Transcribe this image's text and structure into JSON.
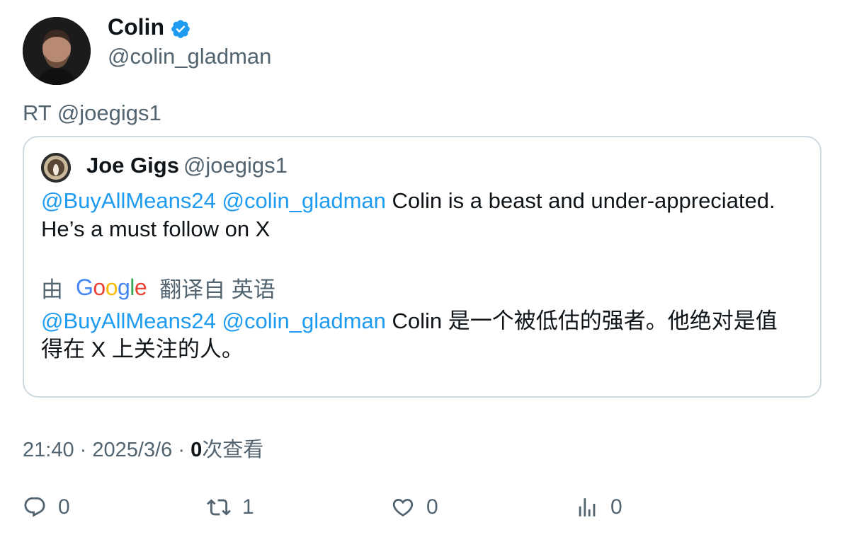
{
  "author": {
    "name": "Colin",
    "handle": "@colin_gladman",
    "verified": true
  },
  "retweet_label": "RT @joegigs1",
  "quoted": {
    "name": "Joe Gigs",
    "handle": "@joegigs1",
    "mentions": [
      "@BuyAllMeans24",
      "@colin_gladman"
    ],
    "text_en_part1": "Colin is a beast and under-appreciated.",
    "text_en_part2": "He’s a must follow on X",
    "translate_prefix": "由",
    "translate_brand": "Google",
    "translate_suffix": "翻译自 英语",
    "text_zh_part1": "Colin 是一个被低估的强者。他绝对是值",
    "text_zh_part2": "得在 X 上关注的人。"
  },
  "meta": {
    "time": "21:40",
    "separator": "·",
    "date": "2025/3/6",
    "views_count": "0",
    "views_label": "次查看"
  },
  "actions": {
    "replies": "0",
    "retweets": "1",
    "likes": "0",
    "views": "0"
  },
  "colors": {
    "link": "#1d9bf0",
    "secondary": "#536471",
    "verified": "#1d9bf0",
    "border": "#cfd9de"
  }
}
